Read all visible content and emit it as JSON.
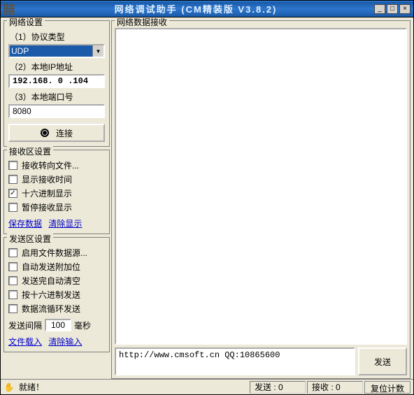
{
  "window": {
    "title": "网络调试助手 (CM精装版 V3.8.2)"
  },
  "network_settings": {
    "title": "网络设置",
    "protocol_label": "（1）协议类型",
    "protocol_value": "UDP",
    "local_ip_label": "（2）本地IP地址",
    "local_ip_value": "192.168. 0 .104",
    "local_port_label": "（3）本地端口号",
    "local_port_value": "8080",
    "connect_label": "连接"
  },
  "recv_settings": {
    "title": "接收区设置",
    "items": [
      {
        "label": "接收转向文件...",
        "checked": false
      },
      {
        "label": "显示接收时间",
        "checked": false
      },
      {
        "label": "十六进制显示",
        "checked": true
      },
      {
        "label": "暂停接收显示",
        "checked": false
      }
    ],
    "save_link": "保存数据",
    "clear_link": "清除显示"
  },
  "send_settings": {
    "title": "发送区设置",
    "items": [
      {
        "label": "启用文件数据源...",
        "checked": false
      },
      {
        "label": "自动发送附加位",
        "checked": false
      },
      {
        "label": "发送完自动清空",
        "checked": false
      },
      {
        "label": "按十六进制发送",
        "checked": false
      },
      {
        "label": "数据流循环发送",
        "checked": false
      }
    ],
    "interval_label": "发送间隔",
    "interval_value": "100",
    "interval_unit": "毫秒",
    "load_link": "文件载入",
    "clear_link": "清除输入"
  },
  "recv_panel": {
    "title": "网络数据接收"
  },
  "send_panel": {
    "content": "http://www.cmsoft.cn QQ:10865600",
    "send_label": "发送"
  },
  "statusbar": {
    "ready": "就绪！",
    "send_count": "发送 : 0",
    "recv_count": "接收 : 0",
    "reset": "复位计数"
  }
}
